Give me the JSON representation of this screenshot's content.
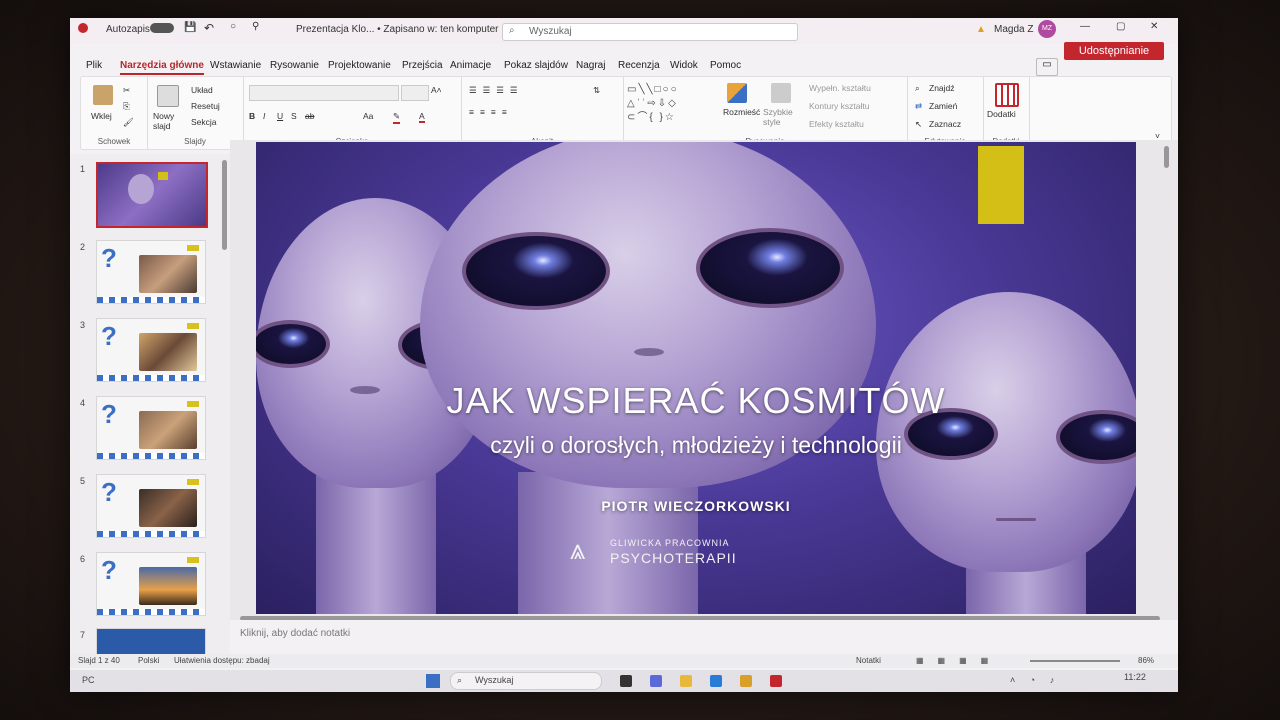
{
  "titlebar": {
    "autosave": "Autozapis",
    "doc_title": "Prezentacja Klo... • Zapisano w: ten komputer",
    "search_placeholder": "Wyszukaj",
    "user": "Magda Z",
    "user_initials": "MZ",
    "share": "Udostępnianie"
  },
  "tabs": [
    "Plik",
    "Narzędzia główne",
    "Wstawianie",
    "Rysowanie",
    "Projektowanie",
    "Przejścia",
    "Animacje",
    "Pokaz slajdów",
    "Nagraj",
    "Recenzja",
    "Widok",
    "Pomoc"
  ],
  "ribbon": {
    "clipboard": {
      "paste": "Wklej",
      "label": "Schowek"
    },
    "slides": {
      "new": "Nowy slajd",
      "layout": "Układ",
      "reset": "Resetuj",
      "section": "Sekcja",
      "label": "Slajdy"
    },
    "font": {
      "label": "Czcionka"
    },
    "paragraph": {
      "label": "Akapit"
    },
    "drawing": {
      "arrange": "Rozmieść",
      "quick_styles": "Szybkie style",
      "fill": "Wypełn. kształtu",
      "outline": "Kontury kształtu",
      "effects": "Efekty kształtu",
      "label": "Rysowanie"
    },
    "editing": {
      "find": "Znajdź",
      "replace": "Zamień",
      "select": "Zaznacz",
      "label": "Edytowanie"
    },
    "addins": {
      "btn": "Dodatki",
      "label": "Dodatki"
    }
  },
  "thumbnails": [
    {
      "num": "1",
      "active": true
    },
    {
      "num": "2",
      "active": false
    },
    {
      "num": "3",
      "active": false
    },
    {
      "num": "4",
      "active": false
    },
    {
      "num": "5",
      "active": false
    },
    {
      "num": "6",
      "active": false
    },
    {
      "num": "7",
      "active": false
    }
  ],
  "slide": {
    "title": "JAK WSPIERAĆ KOSMITÓW",
    "subtitle": "czyli o dorosłych, młodzieży i technologii",
    "author": "PIOTR WIECZORKOWSKI",
    "logo_line1": "GLIWICKA PRACOWNIA",
    "logo_line2": "PSYCHOTERAPII"
  },
  "notes_placeholder": "Kliknij, aby dodać notatki",
  "status": {
    "slide_info": "Slajd 1 z 40",
    "language": "Polski",
    "accessibility": "Ułatwienia dostępu: zbadaj",
    "notes": "Notatki",
    "zoom": "86%"
  },
  "taskbar": {
    "weather": "PC",
    "search": "Wyszukaj",
    "time": "11:22"
  },
  "colors": {
    "accent": "#c4262e",
    "thumb_blue": "#3a6fc4",
    "sticky": "#d4bf16"
  }
}
